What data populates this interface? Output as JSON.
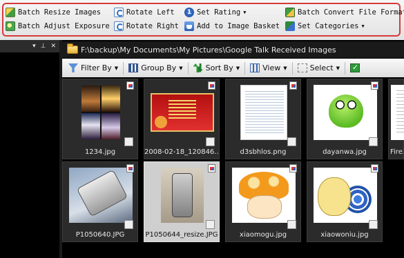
{
  "ribbon": {
    "batch_resize": "Batch Resize Images",
    "batch_adjust": "Batch Adjust Exposure",
    "rotate_left": "Rotate Left",
    "rotate_right": "Rotate Right",
    "set_rating": "Set Rating",
    "rating_icon_text": "1",
    "add_basket": "Add to Image Basket",
    "batch_convert": "Batch Convert File Format",
    "set_categories": "Set Categories",
    "frame_color": "#d63a3a"
  },
  "left_pane": {
    "pin_glyph": "▾",
    "pushpin_glyph": "⊥",
    "close_glyph": "✕"
  },
  "path": {
    "text": "F:\\backup\\My Documents\\My Pictures\\Google Talk Received Images"
  },
  "toolbar": {
    "filter_by": "Filter By",
    "group_by": "Group By",
    "sort_by": "Sort By",
    "view": "View",
    "select": "Select"
  },
  "thumbnails": [
    {
      "name": "1234.jpg",
      "icon": "image-collage",
      "selected": false
    },
    {
      "name": "2008-02-18_120846...",
      "icon": "red-banner",
      "selected": false
    },
    {
      "name": "d3sbhlos.png",
      "icon": "document",
      "selected": false
    },
    {
      "name": "dayanwa.jpg",
      "icon": "green-frog",
      "selected": false
    },
    {
      "name": "FireX",
      "icon": "document",
      "selected": false
    },
    {
      "name": "P1050640.JPG",
      "icon": "phone-photo",
      "selected": false
    },
    {
      "name": "P1050644_resize.JPG",
      "icon": "phone-photo",
      "selected": true
    },
    {
      "name": "xiaomogu.jpg",
      "icon": "mushroom",
      "selected": false
    },
    {
      "name": "xiaowoniu.jpg",
      "icon": "snail",
      "selected": false
    }
  ]
}
